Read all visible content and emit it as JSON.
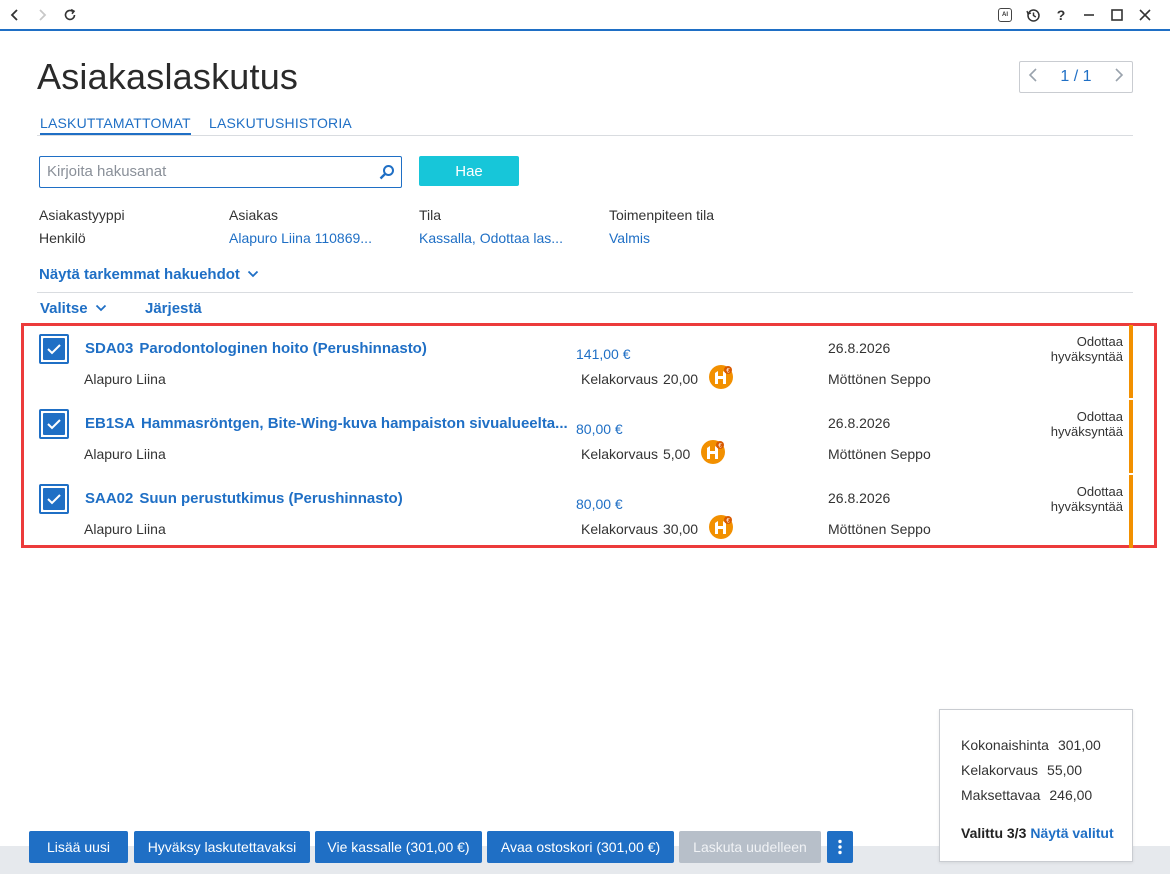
{
  "chrome": {
    "back_icon": "chevron-left-icon",
    "forward_icon": "chevron-right-icon",
    "reload_icon": "reload-icon",
    "ai_label": "AI",
    "history_icon": "history-icon",
    "help_label": "?",
    "minimize_icon": "minimize-icon",
    "maximize_icon": "maximize-icon",
    "close_icon": "close-icon"
  },
  "header": {
    "title": "Asiakaslaskutus",
    "pager": "1 / 1"
  },
  "tabs": [
    {
      "label": "LASKUTTAMATTOMAT",
      "active": true
    },
    {
      "label": "LASKUTUSHISTORIA",
      "active": false
    }
  ],
  "search": {
    "placeholder": "Kirjoita hakusanat",
    "value": "",
    "button_label": "Hae"
  },
  "filters": [
    {
      "label": "Asiakastyyppi",
      "value": "Henkilö",
      "is_link": false
    },
    {
      "label": "Asiakas",
      "value": "Alapuro Liina 110869...",
      "is_link": true
    },
    {
      "label": "Tila",
      "value": "Kassalla, Odottaa las...",
      "is_link": true
    },
    {
      "label": "Toimenpiteen tila",
      "value": "Valmis",
      "is_link": true
    }
  ],
  "more_filters": "Näytä tarkemmat hakuehdot",
  "list_toolbar": {
    "select_label": "Valitse",
    "sort_label": "Järjestä"
  },
  "rows": [
    {
      "code": "SDA03",
      "name": "Parodontologinen hoito (Perushinnasto)",
      "customer": "Alapuro Liina",
      "price": "141,00 €",
      "kela_label": "Kelakorvaus",
      "kela_value": "20,00",
      "date": "26.8.2026",
      "person": "Möttönen Seppo",
      "status_line1": "Odottaa",
      "status_line2": "hyväksyntää",
      "checked": true
    },
    {
      "code": "EB1SA",
      "name": "Hammasröntgen, Bite-Wing-kuva hampaiston sivualueelta...",
      "customer": "Alapuro Liina",
      "price": "80,00 €",
      "kela_label": "Kelakorvaus",
      "kela_value": "5,00",
      "date": "26.8.2026",
      "person": "Möttönen Seppo",
      "status_line1": "Odottaa",
      "status_line2": "hyväksyntää",
      "checked": true
    },
    {
      "code": "SAA02",
      "name": "Suun perustutkimus (Perushinnasto)",
      "customer": "Alapuro Liina",
      "price": "80,00 €",
      "kela_label": "Kelakorvaus",
      "kela_value": "30,00",
      "date": "26.8.2026",
      "person": "Möttönen Seppo",
      "status_line1": "Odottaa",
      "status_line2": "hyväksyntää",
      "checked": true
    }
  ],
  "summary": {
    "total_label": "Kokonaishinta",
    "total_value": "301,00",
    "kela_label": "Kelakorvaus",
    "kela_value": "55,00",
    "pay_label": "Maksettavaa",
    "pay_value": "246,00",
    "selected_label": "Valittu 3/3",
    "show_selected_label": "Näytä valitut"
  },
  "actions": {
    "add_new": "Lisää uusi",
    "approve": "Hyväksy laskutettavaksi",
    "to_cashier": "Vie kassalle (301,00 €)",
    "open_cart": "Avaa ostoskori (301,00 €)",
    "reinvoice": "Laskuta uudelleen"
  },
  "colors": {
    "accent": "#1f6fc5",
    "search_button": "#17c6d9",
    "status_bar": "#f29000",
    "highlight_frame": "#ec3b3b"
  }
}
